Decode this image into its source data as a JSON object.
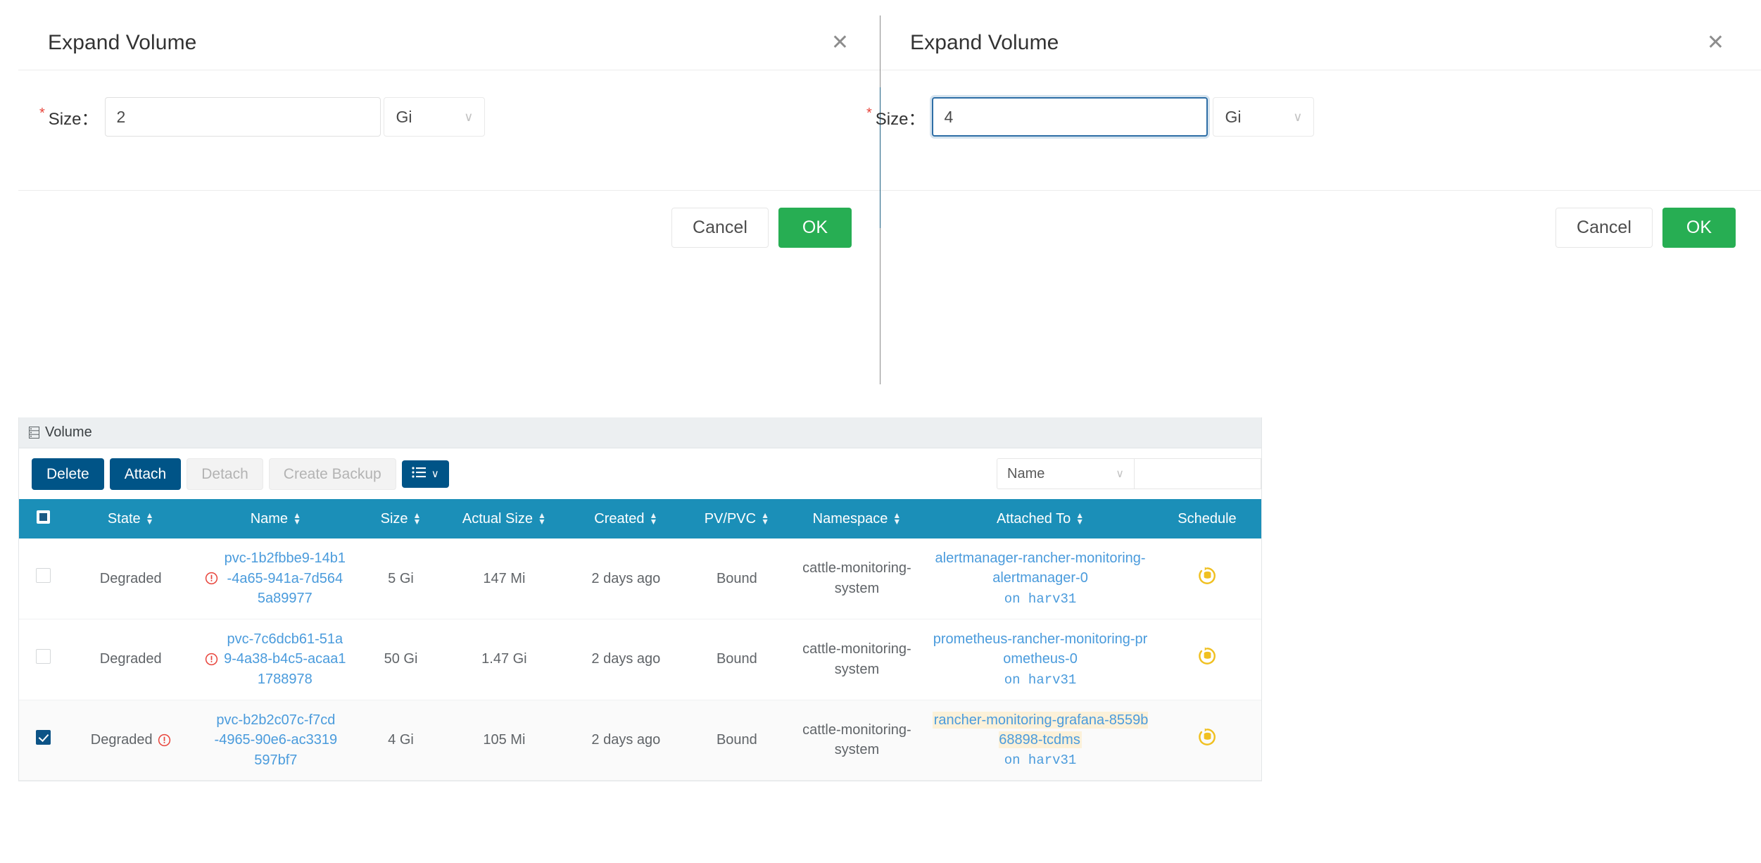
{
  "colors": {
    "accent_navy": "#005487",
    "table_header": "#1b8fb8",
    "ok_green": "#27ae53",
    "link_blue": "#4a9bdc",
    "warn_yellow": "#f0b323",
    "error_red": "#e8453c",
    "highlight_bg": "#fcf1d9",
    "card_header_bg": "#eceff1"
  },
  "dialog_left": {
    "title": "Expand Volume",
    "close_label": "✕",
    "required_mark": "*",
    "size_label": "Size：",
    "size_value": "2",
    "size_placeholder": "",
    "unit_value": "Gi",
    "unit_chevron": "∨",
    "cancel_label": "Cancel",
    "ok_label": "OK"
  },
  "dialog_right": {
    "title": "Expand Volume",
    "close_label": "✕",
    "required_mark": "*",
    "size_label": "Size：",
    "size_value": "4",
    "size_placeholder": "",
    "unit_value": "Gi",
    "unit_chevron": "∨",
    "cancel_label": "Cancel",
    "ok_label": "OK"
  },
  "volume_card": {
    "header_title": "Volume",
    "header_icon": "server-rack-icon",
    "toolbar": {
      "delete_label": "Delete",
      "attach_label": "Attach",
      "detach_label": "Detach",
      "create_backup_label": "Create Backup",
      "list_menu_icon": "list-view-icon",
      "list_menu_caret": "∨",
      "filter_select_value": "Name",
      "filter_select_chevron": "∨",
      "search_placeholder": ""
    },
    "columns": [
      {
        "key": "checkbox",
        "label": "",
        "sortable": false
      },
      {
        "key": "state",
        "label": "State",
        "sortable": true
      },
      {
        "key": "name",
        "label": "Name",
        "sortable": true
      },
      {
        "key": "size",
        "label": "Size",
        "sortable": true
      },
      {
        "key": "actual_size",
        "label": "Actual Size",
        "sortable": true
      },
      {
        "key": "created",
        "label": "Created",
        "sortable": true
      },
      {
        "key": "pvpvc",
        "label": "PV/PVC",
        "sortable": true
      },
      {
        "key": "namespace",
        "label": "Namespace",
        "sortable": true
      },
      {
        "key": "attached_to",
        "label": "Attached To",
        "sortable": true
      },
      {
        "key": "schedule",
        "label": "Schedule",
        "sortable": false
      }
    ],
    "rows": [
      {
        "selected": false,
        "state": "Degraded",
        "state_icon": "error-circle-icon",
        "state_icon_position": "after-name",
        "name": "pvc-1b2fbbe9-14b1-4a65-941a-7d5645a89977",
        "size": "5 Gi",
        "actual_size": "147 Mi",
        "created": "2 days ago",
        "pvpvc": "Bound",
        "namespace": "cattle-monitoring-system",
        "attached_to": "alertmanager-rancher-monitoring-alertmanager-0",
        "attached_to_highlighted": false,
        "attached_on": "on harv31",
        "schedule_icon": "backup-schedule-icon"
      },
      {
        "selected": false,
        "state": "Degraded",
        "state_icon": "error-circle-icon",
        "state_icon_position": "after-name",
        "name": "pvc-7c6dcb61-51a9-4a38-b4c5-acaa11788978",
        "size": "50 Gi",
        "actual_size": "1.47 Gi",
        "created": "2 days ago",
        "pvpvc": "Bound",
        "namespace": "cattle-monitoring-system",
        "attached_to": "prometheus-rancher-monitoring-prometheus-0",
        "attached_to_highlighted": false,
        "attached_on": "on harv31",
        "schedule_icon": "backup-schedule-icon"
      },
      {
        "selected": true,
        "state": "Degraded",
        "state_icon": "error-circle-icon",
        "state_icon_position": "after-state",
        "name": "pvc-b2b2c07c-f7cd-4965-90e6-ac3319597bf7",
        "size": "4 Gi",
        "actual_size": "105 Mi",
        "created": "2 days ago",
        "pvpvc": "Bound",
        "namespace": "cattle-monitoring-system",
        "attached_to": "rancher-monitoring-grafana-8559b68898-tcdms",
        "attached_to_highlighted": true,
        "attached_on": "on harv31",
        "schedule_icon": "backup-schedule-icon"
      }
    ]
  }
}
